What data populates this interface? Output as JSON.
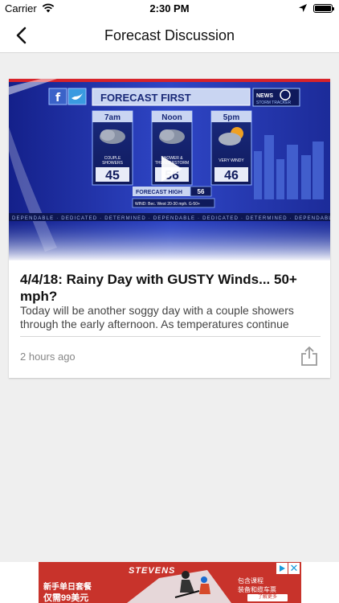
{
  "status": {
    "carrier": "Carrier",
    "time": "2:30 PM"
  },
  "nav": {
    "title": "Forecast Discussion",
    "back_icon": "chevron-left-icon"
  },
  "card": {
    "graphic": {
      "header": "FORECAST FIRST",
      "logo_line1": "NEWS",
      "logo_line2": "STORM TRACKER",
      "periods": [
        {
          "time": "7am",
          "cond": "COUPLE SHOWERS",
          "temp": "45"
        },
        {
          "time": "Noon",
          "cond": "SHOWER & THUNDERSTORM",
          "temp": "56"
        },
        {
          "time": "5pm",
          "cond": "VERY WINDY",
          "temp": "46"
        }
      ],
      "forecast_high_label": "FORECAST HIGH",
      "forecast_high_value": "56",
      "wind": "WIND: Bec. West 20-30 mph. G-50+",
      "ticker": "DEPENDABLE · DEDICATED · DETERMINED · DEPENDABLE · DEDICATED · DETERMINED · DEPENDABLE"
    },
    "title": "4/4/18: Rainy Day with GUSTY Winds... 50+ mph?",
    "summary": "Today will be another soggy day with a couple showers through the early afternoon. As temperatures continue",
    "time_ago": "2 hours ago"
  },
  "ad": {
    "brand": "STEVENS",
    "line1": "新手单日套餐",
    "line2": "仅需99美元",
    "right1": "包含课程",
    "right2": "装备和缆车票",
    "cta": "了解更多"
  },
  "colors": {
    "graphic_blue": "#1f2fa0",
    "ad_red": "#c8332b"
  }
}
